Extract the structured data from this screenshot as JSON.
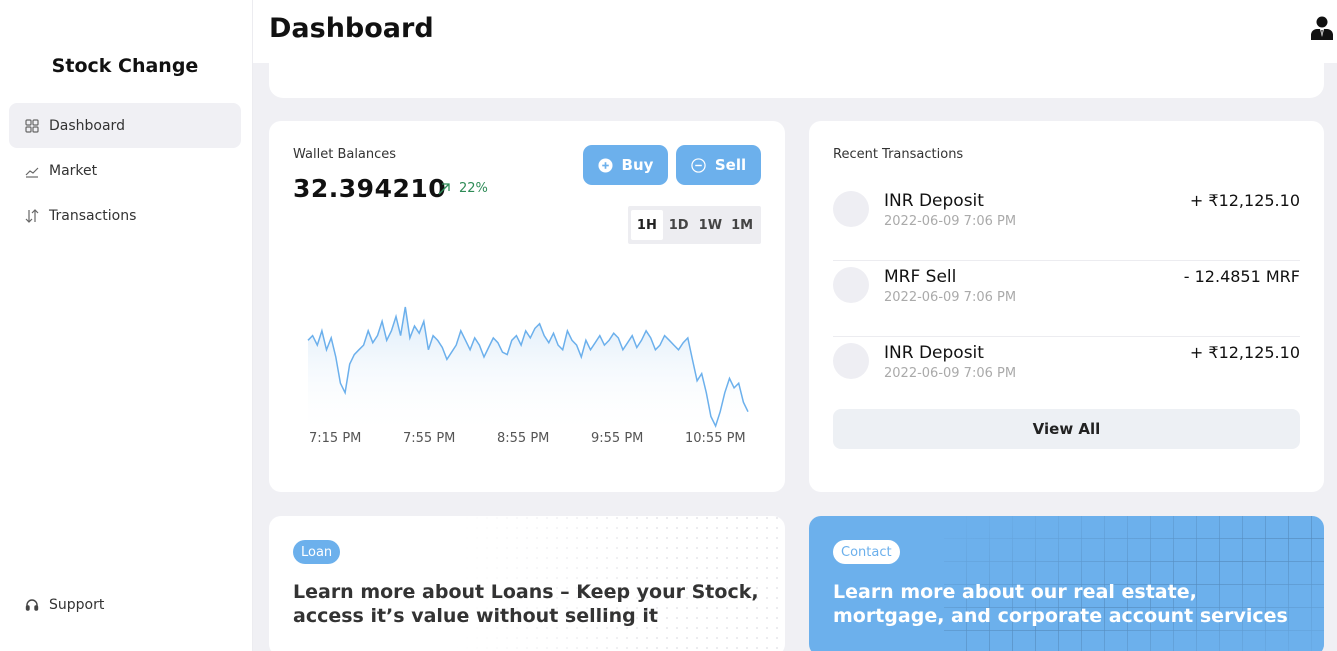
{
  "sidebar": {
    "brand": "Stock Change",
    "items": [
      {
        "label": "Dashboard",
        "icon": "grid-icon",
        "active": true
      },
      {
        "label": "Market",
        "icon": "line-chart-icon"
      },
      {
        "label": "Transactions",
        "icon": "sort-arrows-icon"
      }
    ],
    "support_label": "Support"
  },
  "header": {
    "title": "Dashboard",
    "user_icon": "user-tie-icon"
  },
  "wallet": {
    "title": "Wallet Balances",
    "balance": "32.394210",
    "change": "22%",
    "change_color": "#2e8b57",
    "buy_label": "Buy",
    "sell_label": "Sell",
    "ranges": [
      "1H",
      "1D",
      "1W",
      "1M"
    ],
    "active_range": "1H",
    "accent": "#6cb0ec"
  },
  "chart_data": {
    "type": "area",
    "x_tick_labels": [
      "7:15 PM",
      "7:55 PM",
      "8:55 PM",
      "9:55 PM",
      "10:55 PM"
    ],
    "values": [
      62,
      64,
      60,
      66,
      58,
      63,
      55,
      44,
      40,
      52,
      56,
      58,
      60,
      66,
      61,
      64,
      70,
      62,
      66,
      72,
      64,
      76,
      63,
      68,
      65,
      70,
      58,
      64,
      62,
      59,
      54,
      57,
      60,
      66,
      62,
      58,
      63,
      60,
      55,
      59,
      63,
      61,
      57,
      56,
      62,
      64,
      60,
      66,
      63,
      67,
      69,
      64,
      61,
      65,
      60,
      58,
      66,
      62,
      60,
      55,
      62,
      58,
      61,
      64,
      60,
      62,
      65,
      63,
      58,
      61,
      64,
      59,
      62,
      66,
      63,
      58,
      60,
      64,
      62,
      60,
      58,
      61,
      63,
      54,
      45,
      48,
      40,
      30,
      26,
      32,
      40,
      46,
      42,
      44,
      36,
      32
    ],
    "grid": false,
    "color": "#6cb0ec"
  },
  "recent": {
    "title": "Recent Transactions",
    "transactions": [
      {
        "name": "INR Deposit",
        "time": "2022-06-09 7:06 PM",
        "amount": "+ ₹12,125.10"
      },
      {
        "name": "MRF Sell",
        "time": "2022-06-09 7:06 PM",
        "amount": "- 12.4851 MRF"
      },
      {
        "name": "INR Deposit",
        "time": "2022-06-09 7:06 PM",
        "amount": "+ ₹12,125.10"
      }
    ],
    "view_all_label": "View All"
  },
  "promos": {
    "loan": {
      "tag": "Loan",
      "text": "Learn more about Loans – Keep your Stock, access it’s value without selling it"
    },
    "contact": {
      "tag": "Contact",
      "text": "Learn more about our real estate, mortgage, and corporate account services"
    }
  }
}
